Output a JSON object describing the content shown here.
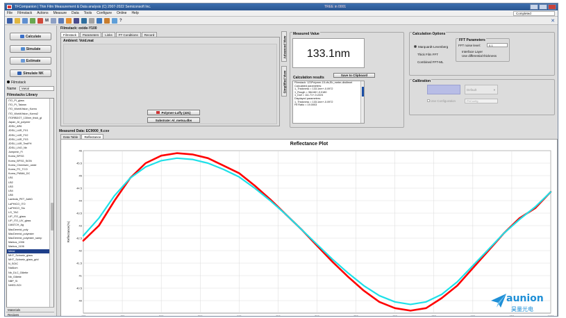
{
  "window": {
    "title": "TFCompanion | Thin Film Measurement & Data analysis (C) 2007-2022 Semiconsoft Inc.",
    "center_title": "TREE in 0001",
    "app_icon": "app-icon"
  },
  "menu": {
    "items": [
      "File",
      "Filmstack",
      "Actions",
      "Measure",
      "Data",
      "Tools",
      "Configure",
      "Online",
      "Help"
    ],
    "status": "Completed"
  },
  "toolbar": {
    "m_label": "M",
    "help_label": "?"
  },
  "left": {
    "calculate": "Calculate",
    "simulate": "Simulate",
    "estimate": "Estimate",
    "simulate_nk": "Simulate NK",
    "filmstack_label": "Filmstack",
    "name_label": "Name",
    "name_value": "Metal",
    "library_title": "Filmstacks Library",
    "library_items": [
      "ITO_PI_glass",
      "ITO_PI_Taiwan",
      "ITO_WorldVision_Korea",
      "ITO_WorldVision_Korea2",
      "ITORBDOT_130nm_thick_gl",
      "Japan_AI_polymer",
      "JDSU_AR6",
      "JDSU_LAR_FX1",
      "JDSU_LAR_FX2",
      "JDSU_LAR_FX3",
      "JDSU_LAR_TestFH",
      "JDSU_LNO_Nb",
      "Jumpmin_Fl",
      "Korea_BFSG",
      "Korea_BFSG_SiON",
      "Korea_Chemisen_oxide",
      "Korea_PC_TCO",
      "Korea_PMMA_DC",
      "LB1",
      "LB2",
      "LB3",
      "LB4",
      "LB5",
      "Lambda_PET_AdhD",
      "LaPHICO_ITO",
      "LaPHICO_Sio",
      "LG_TAC",
      "LIP_ITO_glass",
      "LIP_ITO_UV_glass",
      "LMATCH_Ag",
      "MacDermid_poly",
      "MacDermid_polyester",
      "MacDermid_polyester_samp",
      "Markus_1006",
      "Markus_1106",
      "Metal",
      "MHT_Schnetz_glass",
      "MHT_Schnetz_glass_grid",
      "N_SOIC",
      "NaAlum",
      "Nb_DLC_Gillette",
      "Nb_Gillette",
      "NBP_Si",
      "NHED-SOI"
    ],
    "selected_item": "Metal",
    "bottom_tabs": [
      "Materials",
      "Recipes"
    ]
  },
  "filmstack": {
    "title": "Filmstack: oxide-Y100",
    "tabs": [
      "Filmstack",
      "Parameters",
      "Links",
      "FT Conditions",
      "Record"
    ],
    "ambient": "Ambient: Void.mat",
    "layer_buttons": [
      "Polymer-Luffy (431)",
      "Substrate: Al_metsa.dbs"
    ],
    "vtabs": [
      "Advanced View",
      "Simplified View"
    ]
  },
  "measured_value": {
    "title": "Measured Value",
    "value": "133.1nm",
    "save_button": "Save to Clipboard",
    "results_title": "Calculation results",
    "results_lines": [
      "Filmstack: 123Polymer-15.cfs,Eb_meter-dbditmet",
      "Calculated parameters:",
      "1_Thickness = 133.1nm+-0.0972",
      "1_Rough = 364.66+-0.0180",
      "1_Dull = 111.71+-0.2224",
      "Displayed parameters:",
      "1_Thickness = 133.1nm+-0.0972",
      "Fit Ratio = 19.0003"
    ]
  },
  "calculation_options": {
    "title": "Calculation Options",
    "options": [
      "Marquardt-Levenberg",
      "Thick Film FFT",
      "Combined FFT-ML"
    ],
    "selected": "Marquardt-Levenberg",
    "fft_title": "FFT Parameters",
    "noise_label": "FFT noise level:",
    "noise_value": "0.1",
    "interface_label": "Interface Layer",
    "differential_label": "Use differential thickness"
  },
  "calibration": {
    "title": "Calibration",
    "dropdown": "Default",
    "check_label": "Use Configuration",
    "field_value": "PhConfig"
  },
  "measured_data": {
    "title": "Measured Data: EC9000_fi.csv",
    "tabs": [
      "Data Table",
      "Reflectance"
    ]
  },
  "chart_data": {
    "type": "line",
    "title": "Reflectance Plot",
    "ylabel": "Reflectance(%)",
    "xlabel": "",
    "xlim": [
      400,
      1000
    ],
    "ylim": [
      39.5,
      46
    ],
    "x_ticks": [
      400,
      450,
      500,
      550,
      600,
      650,
      700,
      750,
      800,
      850,
      900,
      950,
      1000
    ],
    "y_ticks": [
      40,
      40.5,
      41,
      41.5,
      42,
      42.5,
      43,
      43.5,
      44,
      44.5,
      45,
      45.5,
      46
    ],
    "grid": true,
    "series": [
      {
        "color": "#ff0000",
        "x": [
          400,
          420,
          440,
          460,
          480,
          500,
          520,
          540,
          560,
          580,
          600,
          620,
          640,
          660,
          680,
          700,
          720,
          740,
          760,
          780,
          800,
          820,
          840,
          860,
          880,
          900,
          920,
          940,
          960,
          980,
          1000
        ],
        "y": [
          42.4,
          43.0,
          44.0,
          44.9,
          45.5,
          45.8,
          45.9,
          45.85,
          45.7,
          45.4,
          45.1,
          44.6,
          44.05,
          43.45,
          42.85,
          42.2,
          41.55,
          40.95,
          40.4,
          39.95,
          39.7,
          39.6,
          39.7,
          40.1,
          40.6,
          41.3,
          42.0,
          42.7,
          43.3,
          43.7,
          44.35
        ]
      },
      {
        "color": "#1ee0e8",
        "x": [
          400,
          420,
          440,
          460,
          480,
          500,
          520,
          540,
          560,
          580,
          600,
          620,
          640,
          660,
          680,
          700,
          720,
          740,
          760,
          780,
          800,
          820,
          840,
          860,
          880,
          900,
          920,
          940,
          960,
          980,
          1000
        ],
        "y": [
          42.6,
          43.3,
          44.2,
          44.9,
          45.35,
          45.6,
          45.7,
          45.65,
          45.5,
          45.25,
          44.95,
          44.5,
          44.0,
          43.45,
          42.85,
          42.25,
          41.65,
          41.1,
          40.6,
          40.2,
          39.95,
          39.85,
          39.95,
          40.25,
          40.75,
          41.4,
          42.05,
          42.7,
          43.25,
          43.75,
          44.35
        ]
      }
    ]
  },
  "watermark": {
    "brand": "aunion",
    "sub": "昊量光电"
  }
}
